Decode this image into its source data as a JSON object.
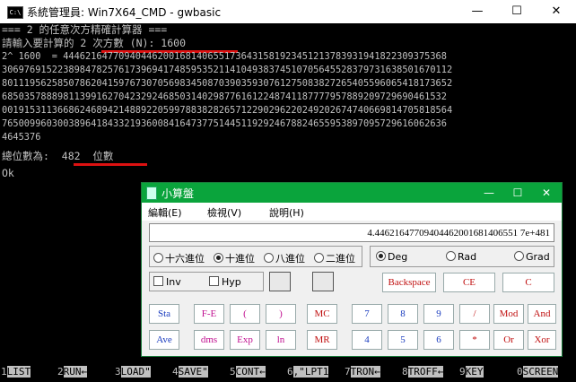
{
  "window": {
    "title": "系統管理員: Win7X64_CMD - gwbasic",
    "app_icon": "C:\\",
    "min": "—",
    "max": "☐",
    "close": "✕"
  },
  "terminal": {
    "lines": [
      "=== 2 的任意次方精確計算器 ===",
      "請輸入要計算的 2 次方數 (N): 1600",
      "2^ 1600  = 444621647709404462001681406551736431581923451213783931941822309375368",
      "306976915223898478257617396941748595352114104938374510705645528379731638501670112",
      "801119562585078620415976730705698345087039035930761275083827265405596065418173652",
      "68503578889811399162704232924685031402987761612248741187777957889209729690461532",
      "001915311366862468942148892205997883828265712290296220249202674740669814705818564",
      "76500996030038964184332193600841647377514451192924678824655953897095729616062636",
      "4645376",
      "總位數為:  482  位數",
      "Ok"
    ]
  },
  "function_keys": [
    {
      "num": "1",
      "label": "LIST"
    },
    {
      "num": "2",
      "label": "RUN←"
    },
    {
      "num": "3",
      "label": "LOAD\""
    },
    {
      "num": "4",
      "label": "SAVE\""
    },
    {
      "num": "5",
      "label": "CONT←"
    },
    {
      "num": "6",
      "label": ",\"LPT1"
    },
    {
      "num": "7",
      "label": "TRON←"
    },
    {
      "num": "8",
      "label": "TROFF←"
    },
    {
      "num": "9",
      "label": "KEY"
    },
    {
      "num": "0",
      "label": "SCREEN"
    }
  ],
  "calculator": {
    "title": "小算盤",
    "menu": [
      "編輯(E)",
      "檢視(V)",
      "說明(H)"
    ],
    "display": "4.44621647709404462001681406551 7e+481",
    "base_options": [
      {
        "label": "十六進位",
        "selected": false
      },
      {
        "label": "十進位",
        "selected": true
      },
      {
        "label": "八進位",
        "selected": false
      },
      {
        "label": "二進位",
        "selected": false
      }
    ],
    "angle_options": [
      {
        "label": "Deg",
        "selected": true
      },
      {
        "label": "Rad",
        "selected": false
      },
      {
        "label": "Grad",
        "selected": false
      }
    ],
    "inv": "Inv",
    "hyp": "Hyp",
    "backspace": "Backspace",
    "ce": "CE",
    "c": "C",
    "row1": [
      "Sta",
      "F-E",
      "(",
      ")",
      "MC",
      "7",
      "8",
      "9",
      "/",
      "Mod",
      "And"
    ],
    "row2": [
      "Ave",
      "dms",
      "Exp",
      "ln",
      "MR",
      "4",
      "5",
      "6",
      "*",
      "Or",
      "Xor"
    ]
  }
}
